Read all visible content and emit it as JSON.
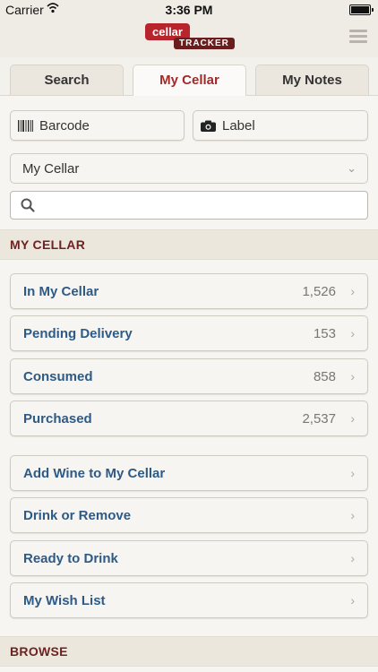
{
  "status": {
    "carrier": "Carrier",
    "time": "3:36 PM"
  },
  "logo": {
    "line1": "cellar",
    "line2": "TRACKER"
  },
  "tabs": [
    {
      "label": "Search"
    },
    {
      "label": "My Cellar"
    },
    {
      "label": "My Notes"
    }
  ],
  "actions": {
    "barcode": "Barcode",
    "label": "Label"
  },
  "select": {
    "value": "My Cellar"
  },
  "search": {
    "placeholder": ""
  },
  "sections": {
    "my_cellar": "MY CELLAR",
    "browse": "BROWSE"
  },
  "cellar_rows": [
    {
      "label": "In My Cellar",
      "count": "1,526"
    },
    {
      "label": "Pending Delivery",
      "count": "153"
    },
    {
      "label": "Consumed",
      "count": "858"
    },
    {
      "label": "Purchased",
      "count": "2,537"
    }
  ],
  "action_rows": [
    {
      "label": "Add Wine to My Cellar"
    },
    {
      "label": "Drink or Remove"
    },
    {
      "label": "Ready to Drink"
    },
    {
      "label": "My Wish List"
    }
  ],
  "icons": {
    "wifi": "wifi-icon",
    "battery": "battery-icon",
    "menu": "hamburger-menu-icon",
    "barcode": "barcode-icon",
    "camera": "camera-icon",
    "search": "search-icon",
    "chevron": "chevron-right-icon"
  },
  "colors": {
    "accent": "#a12a2a",
    "link": "#2d5a86",
    "section_text": "#6e2222"
  }
}
